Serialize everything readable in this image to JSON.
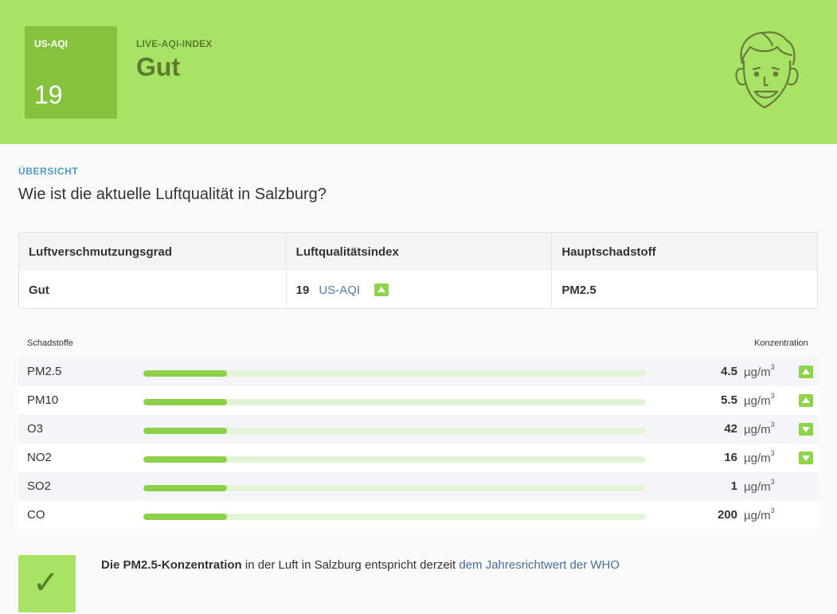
{
  "header": {
    "aqi_label": "US-AQI",
    "aqi_value": "19",
    "subtitle": "LIVE-AQI-INDEX",
    "status": "Gut",
    "face_icon": "smiling-face-icon"
  },
  "overview": {
    "label": "ÜBERSICHT",
    "question": "Wie ist die aktuelle Luftqualität in Salzburg?"
  },
  "summary_table": {
    "headers": [
      "Luftverschmutzungsgrad",
      "Luftqualitätsindex",
      "Hauptschadstoff"
    ],
    "pollution_level": "Gut",
    "aqi_number": "19",
    "aqi_unit": "US-AQI",
    "main_pollutant": "PM2.5",
    "trend_icon": "arrow-up-icon"
  },
  "pollutants": {
    "col_left": "Schadstoffe",
    "col_right": "Konzentration",
    "unit": "µg/m",
    "unit_exp": "3",
    "rows": [
      {
        "name": "PM2.5",
        "value": "4.5",
        "trend": "up"
      },
      {
        "name": "PM10",
        "value": "5.5",
        "trend": "up"
      },
      {
        "name": "O3",
        "value": "42",
        "trend": "down"
      },
      {
        "name": "NO2",
        "value": "16",
        "trend": "down"
      },
      {
        "name": "SO2",
        "value": "1",
        "trend": ""
      },
      {
        "name": "CO",
        "value": "200",
        "trend": ""
      }
    ]
  },
  "who": {
    "check_icon": "checkmark-icon",
    "bold_text": "Die PM2.5-Konzentration",
    "text": " in der Luft in Salzburg entspricht derzeit ",
    "link_text": "dem Jahresrichtwert der WHO"
  },
  "colors": {
    "header_bg": "#a8e365",
    "aqi_box": "#87c23e",
    "bar_fill": "#8dd14a",
    "bar_track": "#e4f4d6",
    "accent_text": "#5e7a2e",
    "overview_label": "#4f9bc2"
  }
}
